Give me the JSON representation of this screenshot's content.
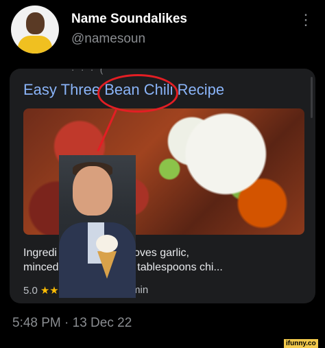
{
  "post": {
    "display_name": "Name Soundalikes",
    "handle": "@namesoun",
    "timestamp": "5:48 PM · 13 Dec 22"
  },
  "card": {
    "title": "Easy Three Bean Chili Recipe",
    "snippet_line1": "Ingredi          ion, diced · 3 cloves garlic,",
    "snippet_line2": "minced          rlic powder) · 3 tablespoons chi...",
    "rating": "5.0",
    "stars": "★★",
    "time": "min"
  },
  "watermark": "ifunny.co"
}
